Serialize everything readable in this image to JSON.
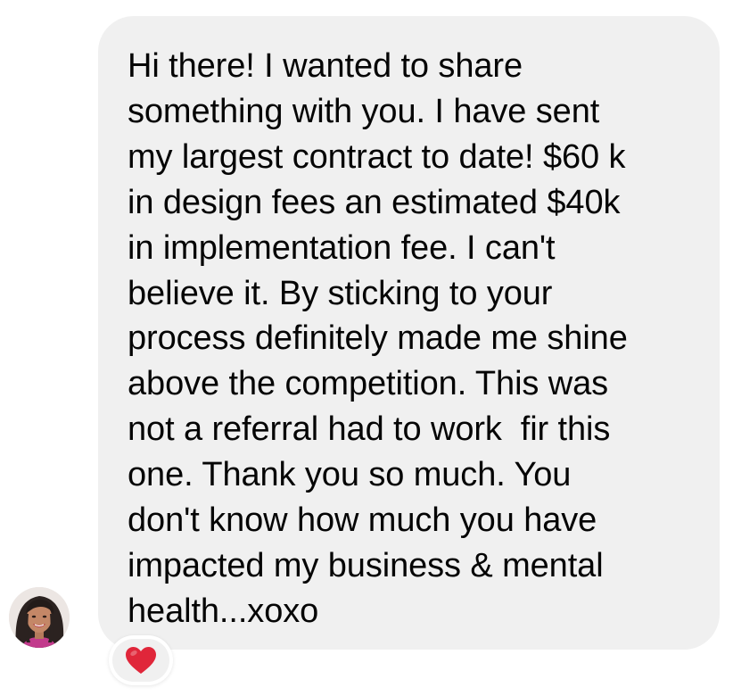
{
  "message": {
    "lines": [
      "Hi there! I wanted to share",
      "something with you. I have sent",
      "my largest contract to date! $60 k",
      "in design fees an estimated $40k",
      "in implementation fee. I can't",
      "believe it. By sticking to your",
      "process definitely made me shine",
      "above the competition. This was",
      "not a referral had to work  fir this",
      "one. Thank you so much. You",
      "don't know how much you have",
      "impacted my business & mental",
      "health...xoxo"
    ]
  },
  "sender": {
    "avatar_icon": "profile-photo-avatar"
  },
  "reaction": {
    "icon": "red-heart-icon",
    "color": "#e0263a"
  },
  "colors": {
    "bubble": "#f0f0f0",
    "text": "#050505"
  }
}
